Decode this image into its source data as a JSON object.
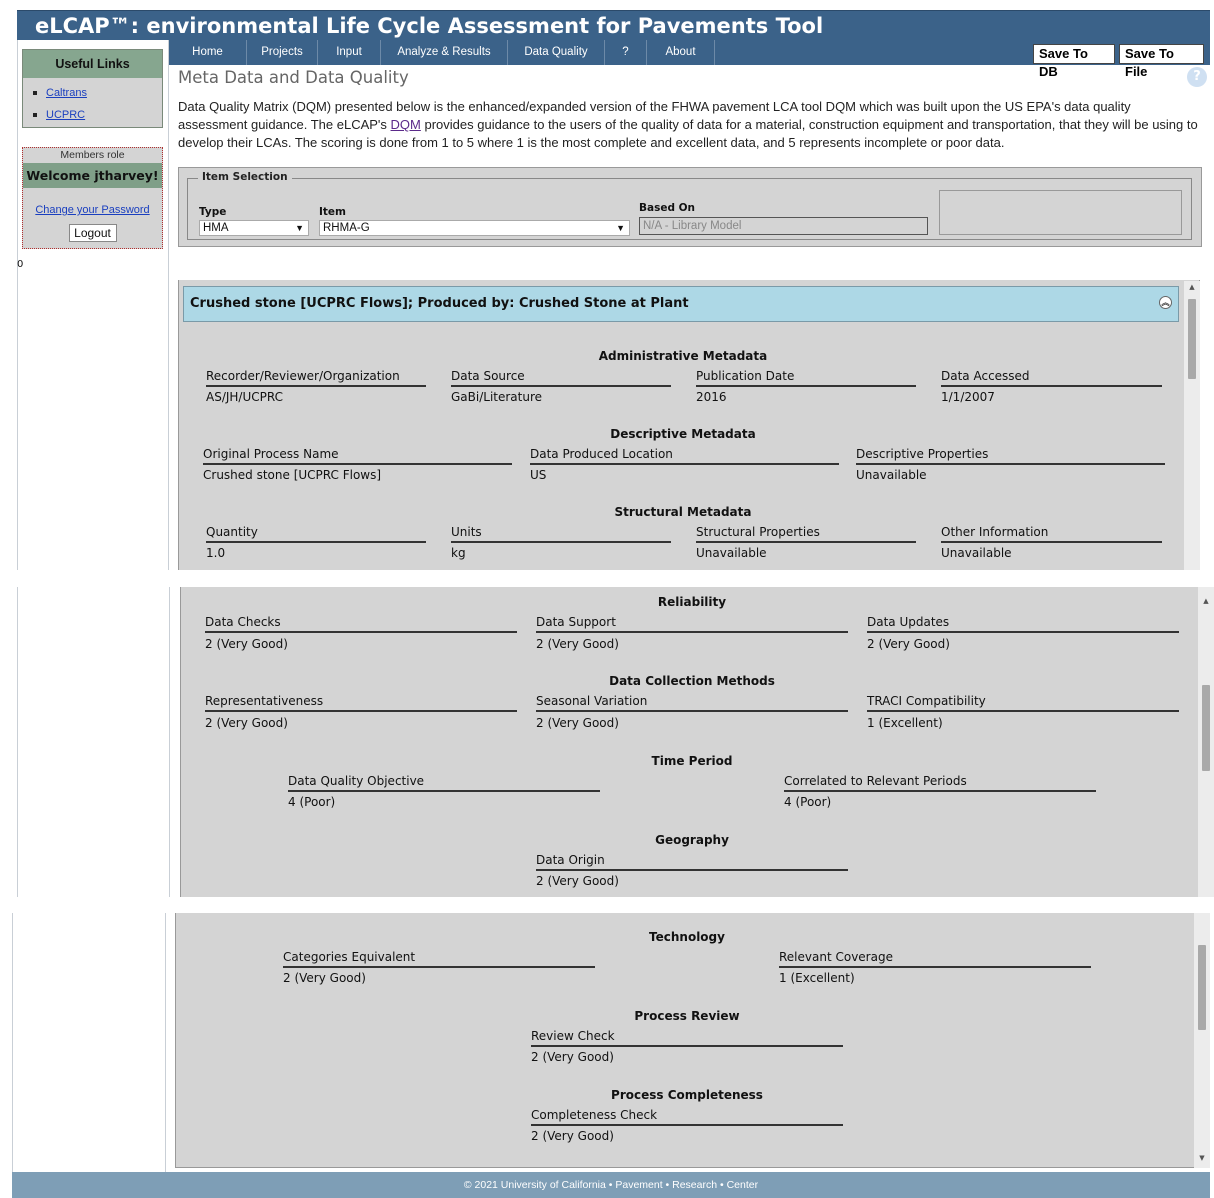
{
  "app": {
    "title": "eLCAP™: environmental Life Cycle Assessment for Pavements Tool"
  },
  "nav": {
    "items": [
      "Home",
      "Projects",
      "Input",
      "Analyze & Results",
      "Data Quality",
      "?",
      "About"
    ],
    "save_db": "Save To DB",
    "save_file": "Save To File"
  },
  "sidebar": {
    "useful_links_title": "Useful Links",
    "links": [
      "Caltrans",
      "UCPRC"
    ],
    "members_role": "Members role",
    "welcome": "Welcome jtharvey!",
    "change_password": "Change your Password",
    "logout": "Logout",
    "counter": "0"
  },
  "page": {
    "title": "Meta Data and Data Quality",
    "help": "?",
    "intro_before": "Data Quality Matrix (DQM) presented below is the enhanced/expanded version of the FHWA pavement LCA tool DQM which was built upon the US EPA's data quality assessment guidance. The eLCAP's ",
    "intro_link": "DQM",
    "intro_after": " provides guidance to the users of the quality of data for a material, construction equipment and transportation, that they will be using to develop their LCAs. The scoring is done from 1 to 5 where 1 is the most complete and excellent data, and 5 represents incomplete or poor data."
  },
  "item_selection": {
    "legend": "Item Selection",
    "type_label": "Type",
    "type_value": "HMA",
    "item_label": "Item",
    "item_value": "RHMA-G",
    "based_on_label": "Based On",
    "based_on_placeholder": "N/A - Library Model"
  },
  "item_header": "Crushed stone [UCPRC Flows]; Produced by: Crushed Stone at Plant",
  "sections": {
    "administrative": {
      "title": "Administrative Metadata",
      "fields": [
        {
          "label": "Recorder/Reviewer/Organization",
          "value": "AS/JH/UCPRC"
        },
        {
          "label": "Data Source",
          "value": "GaBi/Literature"
        },
        {
          "label": "Publication Date",
          "value": "2016"
        },
        {
          "label": "Data Accessed",
          "value": "1/1/2007"
        }
      ]
    },
    "descriptive": {
      "title": "Descriptive Metadata",
      "fields": [
        {
          "label": "Original Process Name",
          "value": "Crushed stone [UCPRC Flows]"
        },
        {
          "label": "Data Produced Location",
          "value": "US"
        },
        {
          "label": "Descriptive Properties",
          "value": "Unavailable"
        }
      ]
    },
    "structural": {
      "title": "Structural Metadata",
      "fields": [
        {
          "label": "Quantity",
          "value": "1.0"
        },
        {
          "label": "Units",
          "value": "kg"
        },
        {
          "label": "Structural Properties",
          "value": "Unavailable"
        },
        {
          "label": "Other Information",
          "value": "Unavailable"
        }
      ]
    },
    "reliability": {
      "title": "Reliability",
      "fields": [
        {
          "label": "Data Checks",
          "value": "2 (Very Good)"
        },
        {
          "label": "Data Support",
          "value": "2 (Very Good)"
        },
        {
          "label": "Data Updates",
          "value": "2 (Very Good)"
        }
      ]
    },
    "collection": {
      "title": "Data Collection Methods",
      "fields": [
        {
          "label": "Representativeness",
          "value": "2 (Very Good)"
        },
        {
          "label": "Seasonal Variation",
          "value": "2 (Very Good)"
        },
        {
          "label": "TRACI Compatibility",
          "value": "1 (Excellent)"
        }
      ]
    },
    "time": {
      "title": "Time Period",
      "fields": [
        {
          "label": "Data Quality Objective",
          "value": "4 (Poor)"
        },
        {
          "label": "Correlated to Relevant Periods",
          "value": "4 (Poor)"
        }
      ]
    },
    "geography": {
      "title": "Geography",
      "fields": [
        {
          "label": "Data Origin",
          "value": "2 (Very Good)"
        }
      ]
    },
    "technology": {
      "title": "Technology",
      "fields": [
        {
          "label": "Categories Equivalent",
          "value": "2 (Very Good)"
        },
        {
          "label": "Relevant Coverage",
          "value": "1 (Excellent)"
        }
      ]
    },
    "review": {
      "title": "Process Review",
      "fields": [
        {
          "label": "Review Check",
          "value": "2 (Very Good)"
        }
      ]
    },
    "completeness": {
      "title": "Process Completeness",
      "fields": [
        {
          "label": "Completeness Check",
          "value": "2 (Very Good)"
        }
      ]
    }
  },
  "footer": {
    "text": "© 2021 University of California • Pavement • Research • Center"
  },
  "colors": {
    "header_blue": "#3b6289",
    "panel_gray": "#d4d4d4",
    "item_header_blue": "#add8e6",
    "sidebar_green": "#86a68f",
    "footer_blue": "#7e9eb6"
  }
}
